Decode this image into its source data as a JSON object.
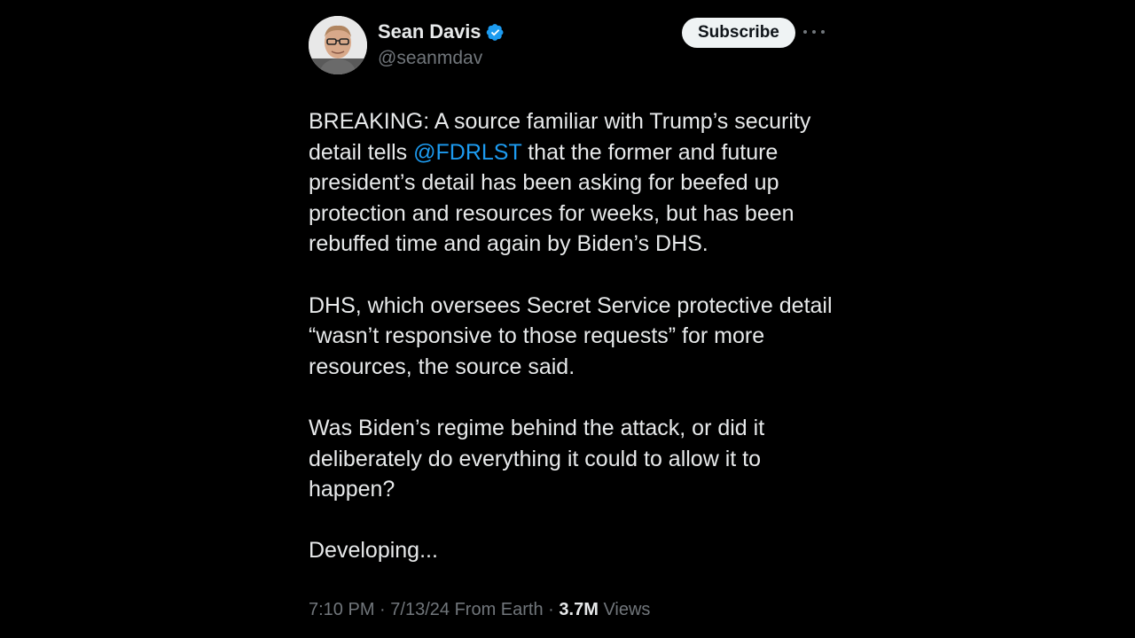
{
  "author": {
    "display_name": "Sean Davis",
    "handle": "@seanmdav",
    "verified": true,
    "avatar_icon": "avatar-photo"
  },
  "actions": {
    "subscribe_label": "Subscribe",
    "more_icon": "more-icon"
  },
  "tweet": {
    "p1_before": "BREAKING: A source familiar with Trump’s security detail tells ",
    "p1_mention": "@FDRLST",
    "p1_after": " that the former and future president’s detail has been asking for beefed up protection and resources for weeks, but has been rebuffed time and again by Biden’s DHS.",
    "p2": "DHS, which oversees Secret Service protective detail “wasn’t responsive to those requests” for more resources, the source said.",
    "p3": "Was Biden’s regime behind the attack, or did it deliberately do everything it could to allow it to happen?",
    "p4": "Developing..."
  },
  "meta": {
    "time": "7:10 PM",
    "separator": "·",
    "date": "7/13/24",
    "source": "From Earth",
    "views_count": "3.7M",
    "views_label": "Views"
  },
  "colors": {
    "background": "#000000",
    "text": "#e7e9ea",
    "secondary": "#71767b",
    "link": "#1d9bf0",
    "verified": "#1d9bf0"
  }
}
